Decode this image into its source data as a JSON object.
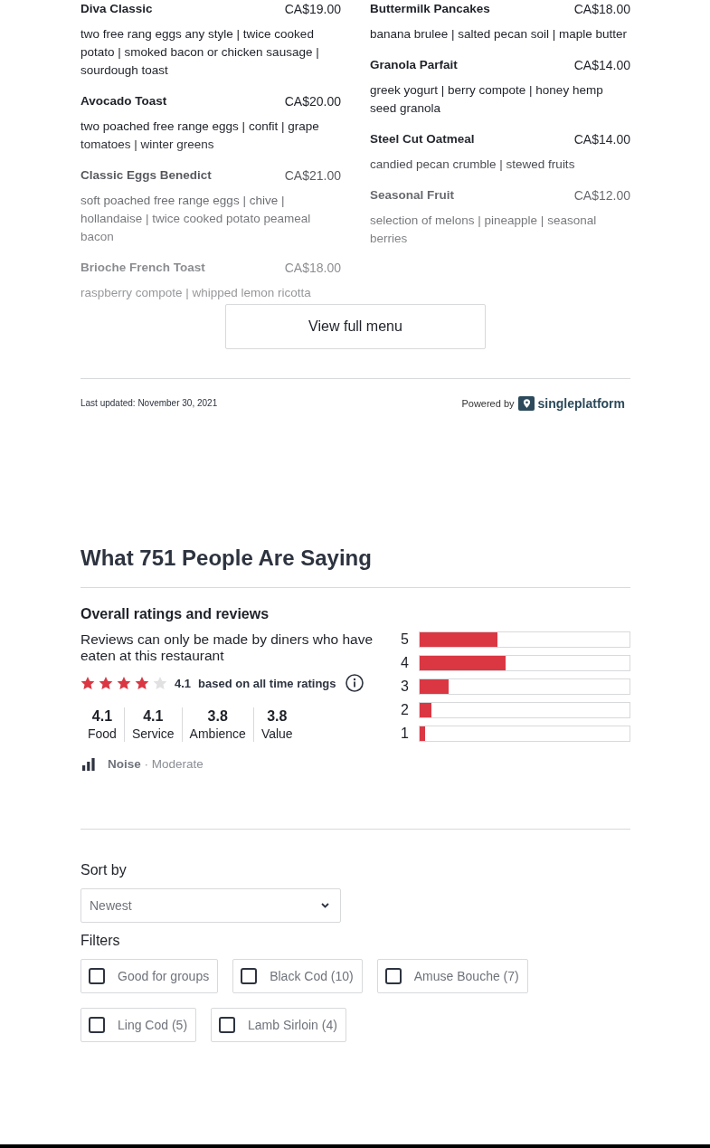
{
  "menu": {
    "columns": [
      {
        "items": [
          {
            "name": "Diva Classic",
            "price": "CA$19.00",
            "description": "two free rang eggs any style | twice cooked potato | smoked bacon or chicken sausage | sourdough toast"
          },
          {
            "name": "Avocado Toast",
            "price": "CA$20.00",
            "description": "two poached free range eggs | confit | grape tomatoes | winter greens"
          },
          {
            "name": "Classic Eggs Benedict",
            "price": "CA$21.00",
            "description": "soft poached free range eggs | chive | hollandaise | twice cooked potato peameal bacon"
          },
          {
            "name": "Brioche French Toast",
            "price": "CA$18.00",
            "description": "raspberry compote | whipped lemon ricotta"
          }
        ]
      },
      {
        "items": [
          {
            "name": "Buttermilk Pancakes",
            "price": "CA$18.00",
            "description": "banana brulee | salted pecan soil | maple butter"
          },
          {
            "name": "Granola Parfait",
            "price": "CA$14.00",
            "description": "greek yogurt | berry compote | honey hemp seed granola"
          },
          {
            "name": "Steel Cut Oatmeal",
            "price": "CA$14.00",
            "description": "candied pecan crumble | stewed fruits"
          },
          {
            "name": "Seasonal Fruit",
            "price": "CA$12.00",
            "description": "selection of melons | pineapple | seasonal berries"
          }
        ]
      }
    ],
    "button": "View full menu",
    "last_updated": "Last updated: November 30, 2021",
    "powered_by": {
      "label": "Powered by",
      "brand": "singleplatform"
    }
  },
  "reviews": {
    "title": "What 751 People Are Saying",
    "overall": {
      "heading": "Overall ratings and reviews",
      "note": "Reviews can only be made by diners who have eaten at this restaurant",
      "stars": 4,
      "score": "4.1",
      "basis": "based on all time ratings",
      "categories": [
        {
          "score": "4.1",
          "label": "Food"
        },
        {
          "score": "4.1",
          "label": "Service"
        },
        {
          "score": "3.8",
          "label": "Ambience"
        },
        {
          "score": "3.8",
          "label": "Value"
        }
      ],
      "noise": "**Noise** · Moderate",
      "distribution": [
        {
          "label": "5",
          "level": 0.37
        },
        {
          "label": "4",
          "level": 0.41
        },
        {
          "label": "3",
          "level": 0.14
        },
        {
          "label": "2",
          "level": 0.055
        },
        {
          "label": "1",
          "level": 0.025
        }
      ]
    },
    "sort": {
      "label": "Sort by",
      "value": "Newest"
    },
    "filters": {
      "label": "Filters",
      "items": [
        {
          "label": "Good for groups",
          "checked": false
        },
        {
          "label": "Black Cod (10)",
          "checked": false
        },
        {
          "label": "Amuse Bouche (7)",
          "checked": false
        },
        {
          "label": "Ling Cod (5)",
          "checked": false
        },
        {
          "label": "Lamb Sirloin (4)",
          "checked": false
        }
      ]
    }
  }
}
